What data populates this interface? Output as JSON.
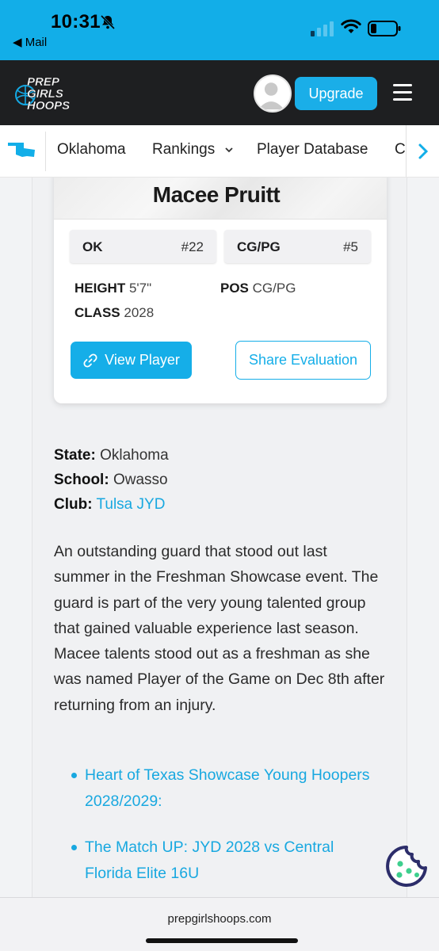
{
  "status_bar": {
    "time": "10:31",
    "back_label": "◀ Mail"
  },
  "header": {
    "logo_lines": [
      "PREP",
      "GIRLS",
      "HOOPS"
    ],
    "upgrade_label": "Upgrade"
  },
  "nav": {
    "items": [
      "Oklahoma",
      "Rankings",
      "Player Database",
      "C"
    ]
  },
  "player": {
    "name": "Macee Pruitt",
    "state_chip": {
      "label": "OK",
      "rank": "#22"
    },
    "position_chip": {
      "label": "CG/PG",
      "rank": "#5"
    },
    "height_label": "HEIGHT",
    "height": "5'7\"",
    "class_label": "CLASS",
    "class": "2028",
    "pos_label": "POS",
    "pos": "CG/PG",
    "view_button": "View Player",
    "share_button": "Share Evaluation"
  },
  "details": {
    "state_label": "State:",
    "state": "Oklahoma",
    "school_label": "School:",
    "school": "Owasso",
    "club_label": "Club:",
    "club": "Tulsa JYD"
  },
  "evaluation": "An outstanding guard that stood out last summer in the Freshman Showcase event. The guard is part of the very young talented group that gained valuable experience last season. Macee talents stood out as a freshman as she was named Player of the Game on Dec 8th after returning from an injury.",
  "links": [
    "Heart of Texas Showcase Young Hoopers 2028/2029:",
    "The Match UP: JYD 2028 vs Central Florida Elite 16U"
  ],
  "url_bar": {
    "domain": "prepgirlshoops.com"
  },
  "colors": {
    "brand_blue": "#12aee8",
    "dark_header": "#1e1f21",
    "cookie_navy": "#2c2d6a",
    "cookie_green": "#3ecf8e"
  },
  "icons": [
    "bell-slash-icon",
    "signal-icon",
    "wifi-icon",
    "battery-icon",
    "avatar-icon",
    "hamburger-menu-icon",
    "oklahoma-state-icon",
    "chevron-down-icon",
    "chevron-right-icon",
    "link-icon",
    "cookie-icon"
  ]
}
